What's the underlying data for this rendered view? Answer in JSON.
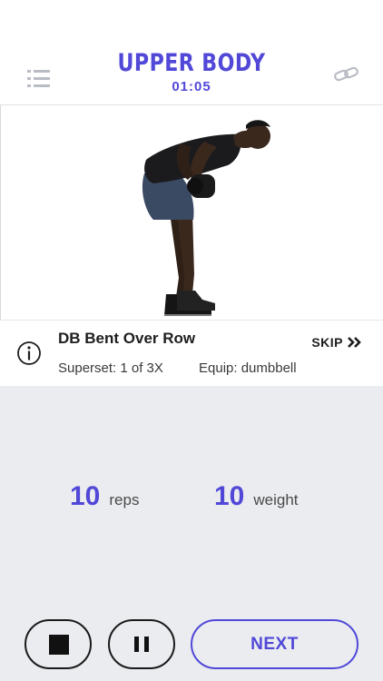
{
  "header": {
    "title": "UPPER BODY",
    "timer": "01:05",
    "menu_icon": "list-icon",
    "link_icon": "link-icon"
  },
  "exercise": {
    "name": "DB Bent Over Row",
    "superset": "Superset: 1 of 3X",
    "equipment": "Equip: dumbbell",
    "skip_label": "SKIP",
    "info_icon": "info-icon"
  },
  "stats": {
    "reps_value": "10",
    "reps_unit": "reps",
    "weight_value": "10",
    "weight_unit": "weight"
  },
  "controls": {
    "next_label": "NEXT"
  },
  "colors": {
    "accent": "#5148d8",
    "panel": "#eaecef"
  }
}
